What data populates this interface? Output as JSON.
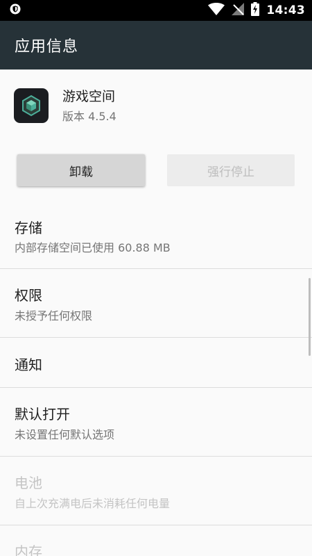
{
  "status_bar": {
    "time": "14:43",
    "icons": [
      "shield-notification-icon",
      "wifi-icon",
      "signal-off-icon",
      "battery-charging-icon"
    ]
  },
  "app_bar": {
    "title": "应用信息"
  },
  "app": {
    "name": "游戏空间",
    "version": "版本 4.5.4",
    "icon": "game-cube-icon"
  },
  "buttons": {
    "uninstall": "卸载",
    "force_stop": "强行停止"
  },
  "items": [
    {
      "title": "存储",
      "subtitle": "内部存储空间已使用 60.88 MB"
    },
    {
      "title": "权限",
      "subtitle": "未授予任何权限"
    },
    {
      "title": "通知"
    },
    {
      "title": "默认打开",
      "subtitle": "未设置任何默认选项"
    },
    {
      "title": "电池",
      "subtitle": "自上次充满电后未消耗任何电量"
    },
    {
      "title": "内存"
    }
  ],
  "colors": {
    "status_bar": "#000000",
    "app_bar": "#263238",
    "background": "#fafafa",
    "icon_accent": "#4caf9a"
  }
}
